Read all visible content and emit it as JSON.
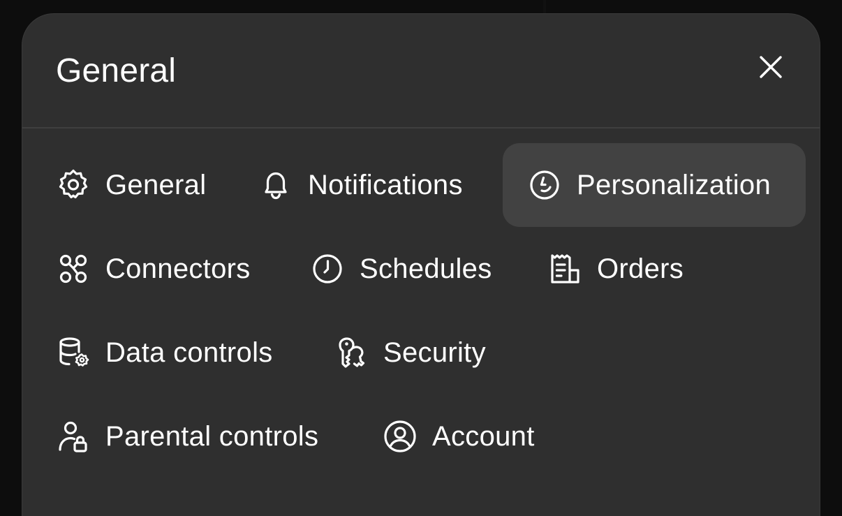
{
  "dialog": {
    "title": "General",
    "close_icon": "close-icon"
  },
  "menu": {
    "selected": "Personalization",
    "items": [
      {
        "label": "General",
        "icon": "gear-icon"
      },
      {
        "label": "Notifications",
        "icon": "bell-icon"
      },
      {
        "label": "Personalization",
        "icon": "smiley-icon"
      },
      {
        "label": "Connectors",
        "icon": "connectors-icon"
      },
      {
        "label": "Schedules",
        "icon": "clock-icon"
      },
      {
        "label": "Orders",
        "icon": "receipt-icon"
      },
      {
        "label": "Data controls",
        "icon": "database-gear-icon"
      },
      {
        "label": "Security",
        "icon": "keys-icon"
      },
      {
        "label": "Parental controls",
        "icon": "user-lock-icon"
      },
      {
        "label": "Account",
        "icon": "user-circle-icon"
      }
    ]
  },
  "colors": {
    "backdrop": "#0d0d0d",
    "panel": "#2f2f2f",
    "selected_item": "#424242",
    "text": "#ffffff"
  }
}
